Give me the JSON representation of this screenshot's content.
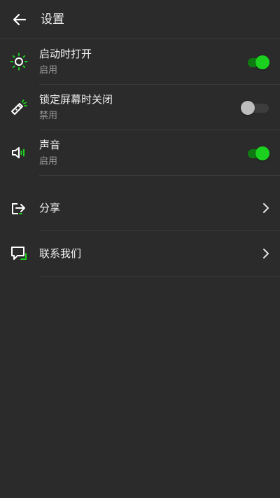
{
  "header": {
    "title": "设置"
  },
  "settings": [
    {
      "id": "startup",
      "title": "启动时打开",
      "status": "启用",
      "enabled": true,
      "icon": "sun-icon"
    },
    {
      "id": "lock",
      "title": "锁定屏幕时关闭",
      "status": "禁用",
      "enabled": false,
      "icon": "flashlight-icon"
    },
    {
      "id": "sound",
      "title": "声音",
      "status": "启用",
      "enabled": true,
      "icon": "speaker-icon"
    }
  ],
  "links": [
    {
      "id": "share",
      "title": "分享",
      "icon": "share-icon"
    },
    {
      "id": "contact",
      "title": "联系我们",
      "icon": "chat-icon"
    }
  ],
  "colors": {
    "background": "#2b2b2b",
    "accent": "#1bd01f",
    "accent_dark": "#0f7a12",
    "text": "#f2f2f2",
    "subtext": "#9a9a9a",
    "divider": "#3a3a3a"
  }
}
